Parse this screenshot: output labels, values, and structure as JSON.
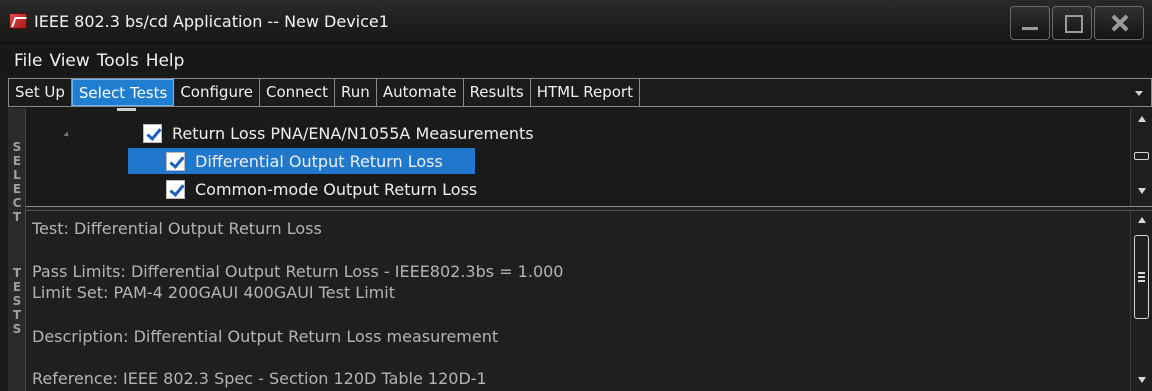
{
  "window": {
    "title": "IEEE 802.3 bs/cd Application -- New Device1"
  },
  "menu": [
    "File",
    "View",
    "Tools",
    "Help"
  ],
  "tabs": [
    {
      "label": "Set Up",
      "active": false
    },
    {
      "label": "Select Tests",
      "active": true
    },
    {
      "label": "Configure",
      "active": false
    },
    {
      "label": "Connect",
      "active": false
    },
    {
      "label": "Run",
      "active": false
    },
    {
      "label": "Automate",
      "active": false
    },
    {
      "label": "Results",
      "active": false
    },
    {
      "label": "HTML Report",
      "active": false
    }
  ],
  "side_label": [
    "S",
    "E",
    "L",
    "E",
    "C",
    "T",
    " ",
    "T",
    "E",
    "S",
    "T",
    "S"
  ],
  "tree": {
    "group": {
      "label": "Return Loss PNA/ENA/N1055A Measurements",
      "checked": true
    },
    "items": [
      {
        "label": "Differential Output Return Loss",
        "checked": true,
        "selected": true
      },
      {
        "label": "Common-mode Output Return Loss",
        "checked": true,
        "selected": false
      }
    ]
  },
  "details": {
    "test": "Test: Differential Output Return Loss",
    "pass_limits": "Pass Limits: Differential Output Return Loss - IEEE802.3bs = 1.000",
    "limit_set": "Limit Set: PAM-4 200GAUI 400GAUI Test Limit",
    "description": "Description: Differential Output Return Loss measurement",
    "reference": "Reference: IEEE 802.3 Spec - Section 120D Table 120D-1"
  },
  "colors": {
    "accent": "#1f7ed0",
    "background": "#1a1a1a",
    "text": "#e8e8e8",
    "muted_text": "#b4b4b4"
  }
}
